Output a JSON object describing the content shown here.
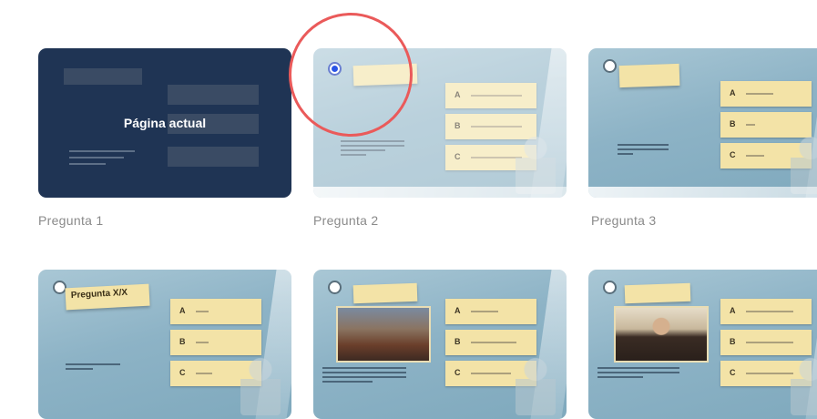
{
  "slides": [
    {
      "caption": "Pregunta 1",
      "overlay_label": "Página actual"
    },
    {
      "caption": "Pregunta 2"
    },
    {
      "caption": "Pregunta 3"
    },
    {
      "tag": "Pregunta X/X"
    },
    {},
    {}
  ],
  "answer_letters": [
    "A",
    "B",
    "C"
  ],
  "colors": {
    "current_overlay": "#1f3454",
    "sticky_note": "#f3e3a7",
    "radio_selected": "#2b55e6",
    "highlight_circle": "#ea5a5a"
  },
  "icons": [
    "radio-selected-icon",
    "radio-icon"
  ]
}
